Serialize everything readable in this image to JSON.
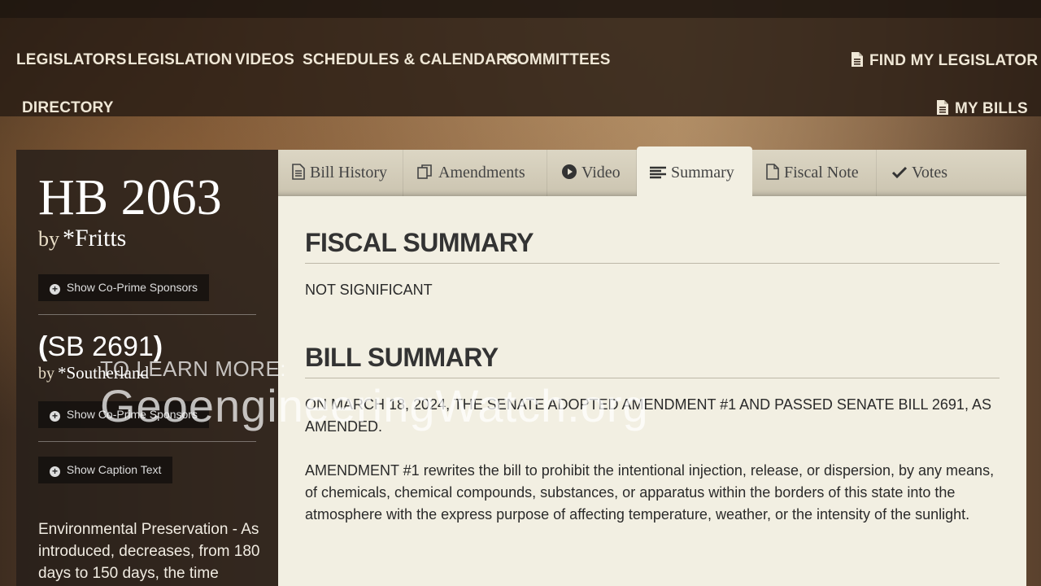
{
  "nav": {
    "legislators": "LEGISLATORS",
    "legislation": "LEGISLATION",
    "videos": "VIDEOS",
    "schedules": "SCHEDULES & CALENDARS",
    "committees": "COMMITTEES",
    "directory": "DIRECTORY",
    "find_legislator": "FIND MY LEGISLATOR",
    "my_bills": "MY BILLS"
  },
  "sidebar": {
    "bill_number": "HB 2063",
    "by": "by",
    "sponsor": "*Fritts",
    "show_co_prime": "Show Co-Prime Sponsors",
    "companion_open": "(",
    "companion_bill": "SB 2691",
    "companion_close": ")",
    "companion_sponsor": "*Southerland",
    "show_co_prime_2": "Show Co-Prime Sponsors",
    "show_caption": "Show Caption Text",
    "caption": "Environmental Preservation - As introduced, decreases, from 180 days to 150 days, the time"
  },
  "tabs": [
    {
      "label": "Bill History",
      "icon": "document-icon"
    },
    {
      "label": "Amendments",
      "icon": "copy-icon"
    },
    {
      "label": "Video",
      "icon": "play-icon"
    },
    {
      "label": "Summary",
      "icon": "lines-icon"
    },
    {
      "label": "Fiscal Note",
      "icon": "file-icon"
    },
    {
      "label": "Votes",
      "icon": "check-icon"
    }
  ],
  "content": {
    "fiscal_heading": "FISCAL SUMMARY",
    "fiscal_text": "NOT SIGNIFICANT",
    "bill_heading": "BILL SUMMARY",
    "bill_text_1": "ON MARCH 18, 2024, THE SENATE ADOPTED AMENDMENT #1 AND PASSED SENATE BILL 2691, AS AMENDED.",
    "bill_text_2": "AMENDMENT #1 rewrites the bill to prohibit the intentional injection, release, or dispersion, by any means, of chemicals, chemical compounds, substances, or apparatus within the borders of this state into the atmosphere with the express purpose of affecting temperature, weather, or the intensity of the sunlight."
  },
  "watermark": {
    "line1": "TO LEARN MORE:",
    "line2": "GeoengineeringWatch.org"
  }
}
